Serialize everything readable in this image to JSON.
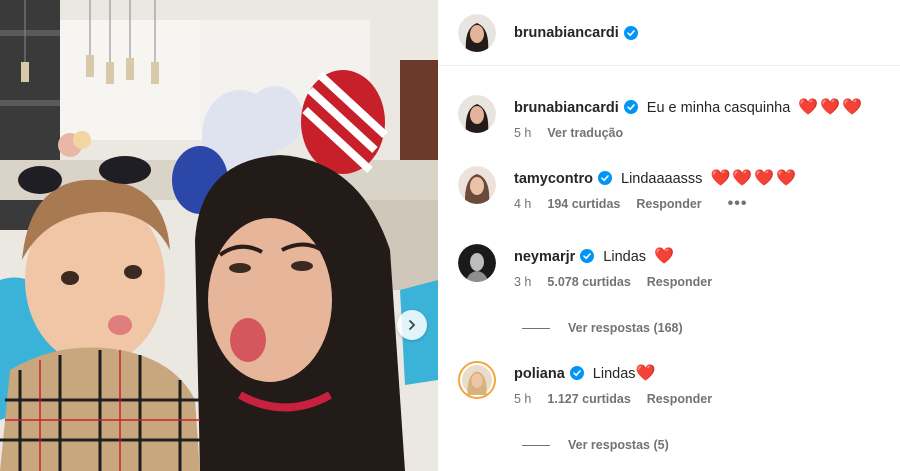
{
  "photo": {
    "alt": "",
    "colors": {
      "wall": "#ece9e3",
      "cabinet": "#f4f3ef",
      "chair": "#3bb3d8",
      "balloon_red": "#c8202b"
    }
  },
  "header": {
    "username": "brunabiancardi",
    "verified": true
  },
  "caption": {
    "username": "brunabiancardi",
    "verified": true,
    "text": "Eu e minha casquinha",
    "hearts": "❤️❤️❤️",
    "time": "5 h",
    "translate": "Ver tradução"
  },
  "comments": [
    {
      "username": "tamycontro",
      "verified": true,
      "text": "Lindaaaasss",
      "hearts": "❤️❤️❤️❤️",
      "time": "4 h",
      "likes": "194 curtidas",
      "reply": "Responder",
      "more": "•••",
      "view_replies": ""
    },
    {
      "username": "neymarjr",
      "verified": true,
      "text": "Lindas",
      "hearts": "❤️",
      "time": "3 h",
      "likes": "5.078 curtidas",
      "reply": "Responder",
      "view_replies": "Ver respostas (168)"
    },
    {
      "username": "poliana",
      "verified": true,
      "text": "Lindas",
      "hearts": "❤️",
      "time": "5 h",
      "likes": "1.127 curtidas",
      "reply": "Responder",
      "view_replies": "Ver respostas (5)"
    }
  ],
  "icons": {
    "verified": "verified-badge-icon",
    "next": "chevron-right-icon"
  },
  "accent": {
    "verified_blue": "#0095f6",
    "heart_red": "#ed4956"
  }
}
